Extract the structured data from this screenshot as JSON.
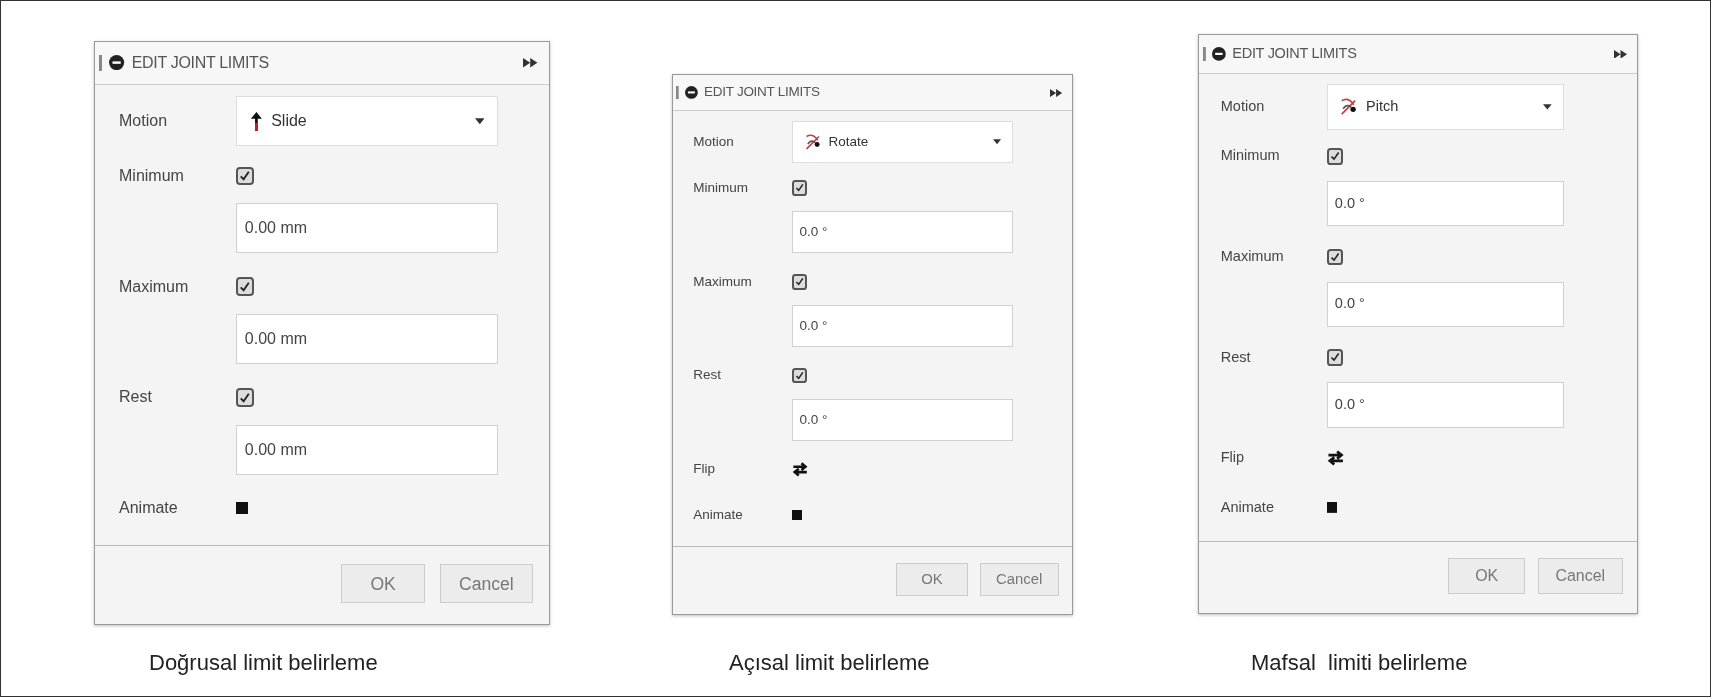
{
  "panels": [
    {
      "title": "EDIT JOINT LIMITS",
      "rows": [
        {
          "kind": "linear",
          "label": "Motion",
          "value": "Slide"
        },
        {
          "kind": "check",
          "label": "Minimum",
          "checked": true
        },
        {
          "kind": "field",
          "value": "0.00 mm"
        },
        {
          "kind": "check",
          "label": "Maximum",
          "checked": true
        },
        {
          "kind": "field",
          "value": "0.00 mm"
        },
        {
          "kind": "check",
          "label": "Rest",
          "checked": true
        },
        {
          "kind": "field",
          "value": "0.00 mm"
        },
        {
          "kind": "animate",
          "label": "Animate"
        }
      ],
      "buttons": [
        "OK",
        "Cancel"
      ],
      "caption": "Doğrusal limit belirleme"
    },
    {
      "title": "EDIT JOINT LIMITS",
      "rows": [
        {
          "kind": "angular",
          "label": "Motion",
          "value": "Rotate"
        },
        {
          "kind": "check",
          "label": "Minimum",
          "checked": true
        },
        {
          "kind": "field",
          "value": "0.0 °"
        },
        {
          "kind": "check",
          "label": "Maximum",
          "checked": true
        },
        {
          "kind": "field",
          "value": "0.0 °"
        },
        {
          "kind": "check",
          "label": "Rest",
          "checked": true
        },
        {
          "kind": "field",
          "value": "0.0 °"
        },
        {
          "kind": "flip",
          "label": "Flip"
        },
        {
          "kind": "animate",
          "label": "Animate"
        }
      ],
      "buttons": [
        "OK",
        "Cancel"
      ],
      "caption": "Açısal limit belirleme"
    },
    {
      "title": "EDIT JOINT LIMITS",
      "rows": [
        {
          "kind": "angular",
          "label": "Motion",
          "value": "Pitch"
        },
        {
          "kind": "check",
          "label": "Minimum",
          "checked": true
        },
        {
          "kind": "field",
          "value": "0.0 °"
        },
        {
          "kind": "check",
          "label": "Maximum",
          "checked": true
        },
        {
          "kind": "field",
          "value": "0.0 °"
        },
        {
          "kind": "check",
          "label": "Rest",
          "checked": true
        },
        {
          "kind": "field",
          "value": "0.0 °"
        },
        {
          "kind": "flip",
          "label": "Flip"
        },
        {
          "kind": "animate",
          "label": "Animate"
        }
      ],
      "buttons": [
        "OK",
        "Cancel"
      ],
      "caption": "Mafsal  limiti belirleme"
    }
  ]
}
